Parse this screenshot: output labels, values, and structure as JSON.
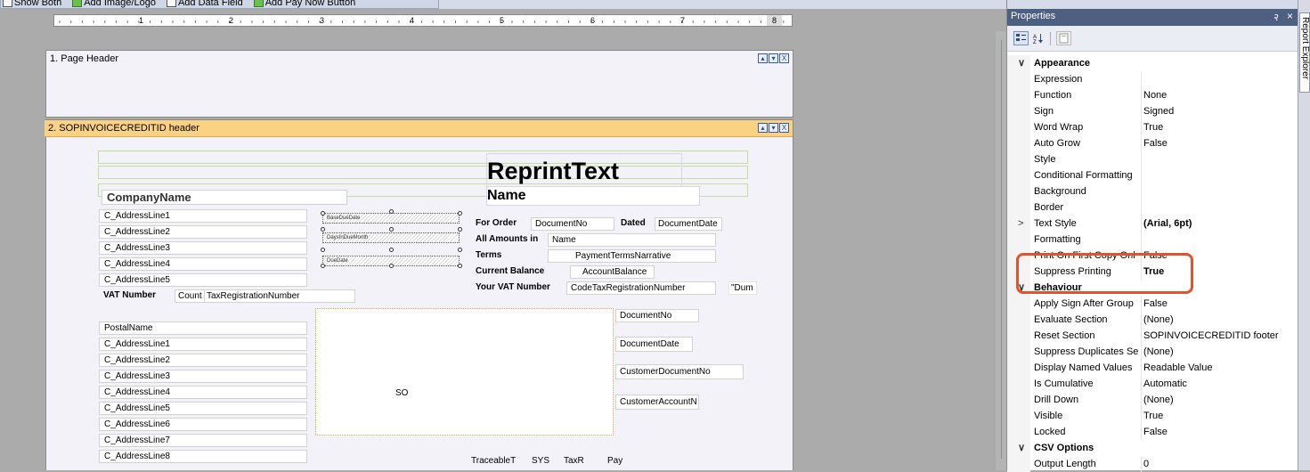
{
  "toolbar": {
    "items": [
      {
        "label": "Show Both",
        "icon": "show-both-icon"
      },
      {
        "label": "Add Image/Logo",
        "icon": "image-icon"
      },
      {
        "label": "Add Data Field",
        "icon": "data-field-icon"
      },
      {
        "label": "Add Pay Now Button",
        "icon": "pay-now-icon"
      }
    ]
  },
  "ruler": {
    "numbers": [
      "1",
      "2",
      "3",
      "4",
      "5",
      "6",
      "7",
      "8"
    ]
  },
  "bands": {
    "page_header": "1. Page Header",
    "group_header": "2. SOPINVOICECREDITID header",
    "buttons": [
      "▴",
      "▾",
      "X"
    ]
  },
  "report": {
    "reprint_text": "ReprintText",
    "name_title": "Name",
    "company_name": "CompanyName",
    "address_lines": [
      "C_AddressLine1",
      "C_AddressLine2",
      "C_AddressLine3",
      "C_AddressLine4",
      "C_AddressLine5"
    ],
    "vat_label": "VAT Number",
    "vat_country": "Count",
    "vat_number": "TaxRegistrationNumber",
    "hatched": [
      "BaseDueDate",
      "DaysInDueMonth",
      "DueDate"
    ],
    "for_order_label": "For Order",
    "document_no": "DocumentNo",
    "dated_label": "Dated",
    "document_date": "DocumentDate",
    "all_amounts_label": "All Amounts in",
    "currency_name": "Name",
    "terms_label": "Terms",
    "terms_value": "PaymentTermsNarrative",
    "current_balance_label": "Current Balance",
    "account_balance": "AccountBalance",
    "your_vat_label": "Your VAT Number",
    "code_tax_reg": "CodeTaxRegistrationNumber",
    "dum": "\"Dum",
    "postal_name": "PostalName",
    "postal_lines": [
      "C_AddressLine1",
      "C_AddressLine2",
      "C_AddressLine3",
      "C_AddressLine4",
      "C_AddressLine5",
      "C_AddressLine6",
      "C_AddressLine7",
      "C_AddressLine8"
    ],
    "so_label": "SO",
    "right_fields": [
      "DocumentNo",
      "DocumentDate",
      "CustomerDocumentNo",
      "CustomerAccountN"
    ],
    "bottom_fields": [
      "TraceableT",
      "SYS",
      "TaxR",
      "Pay"
    ]
  },
  "properties": {
    "title": "Properties",
    "pin": "२",
    "close": "×",
    "dock_tab": "Report Explorer",
    "rows": [
      {
        "type": "cat",
        "name": "Appearance",
        "chevron": "∨"
      },
      {
        "name": "Expression",
        "value": ""
      },
      {
        "name": "Function",
        "value": "None"
      },
      {
        "name": "Sign",
        "value": "Signed"
      },
      {
        "name": "Word Wrap",
        "value": "True"
      },
      {
        "name": "Auto Grow",
        "value": "False"
      },
      {
        "name": "Style",
        "value": ""
      },
      {
        "name": "Conditional Formatting",
        "value": ""
      },
      {
        "name": "Background",
        "value": ""
      },
      {
        "name": "Border",
        "value": ""
      },
      {
        "name": "Text Style",
        "value": "(Arial, 6pt)",
        "bold": true,
        "chevron": ">"
      },
      {
        "name": "Formatting",
        "value": ""
      },
      {
        "name": "Print On First Copy Onl",
        "value": "False"
      },
      {
        "name": "Suppress Printing",
        "value": "True",
        "bold_value": true
      },
      {
        "type": "cat",
        "name": "Behaviour",
        "chevron": "∨"
      },
      {
        "name": "Apply Sign After Group",
        "value": "False"
      },
      {
        "name": "Evaluate Section",
        "value": "(None)"
      },
      {
        "name": "Reset Section",
        "value": "SOPINVOICECREDITID footer"
      },
      {
        "name": "Suppress Duplicates Se",
        "value": "(None)"
      },
      {
        "name": "Display Named Values",
        "value": "Readable Value"
      },
      {
        "name": "Is Cumulative",
        "value": "Automatic"
      },
      {
        "name": "Drill Down",
        "value": "(None)"
      },
      {
        "name": "Visible",
        "value": "True"
      },
      {
        "name": "Locked",
        "value": "False"
      },
      {
        "type": "cat",
        "name": "CSV Options",
        "chevron": "∨"
      },
      {
        "name": "Output Length",
        "value": "0"
      }
    ]
  },
  "colors": {
    "band_header": "#fbd183",
    "props_title_bg": "#4d6082",
    "highlight": "#e0532c"
  }
}
